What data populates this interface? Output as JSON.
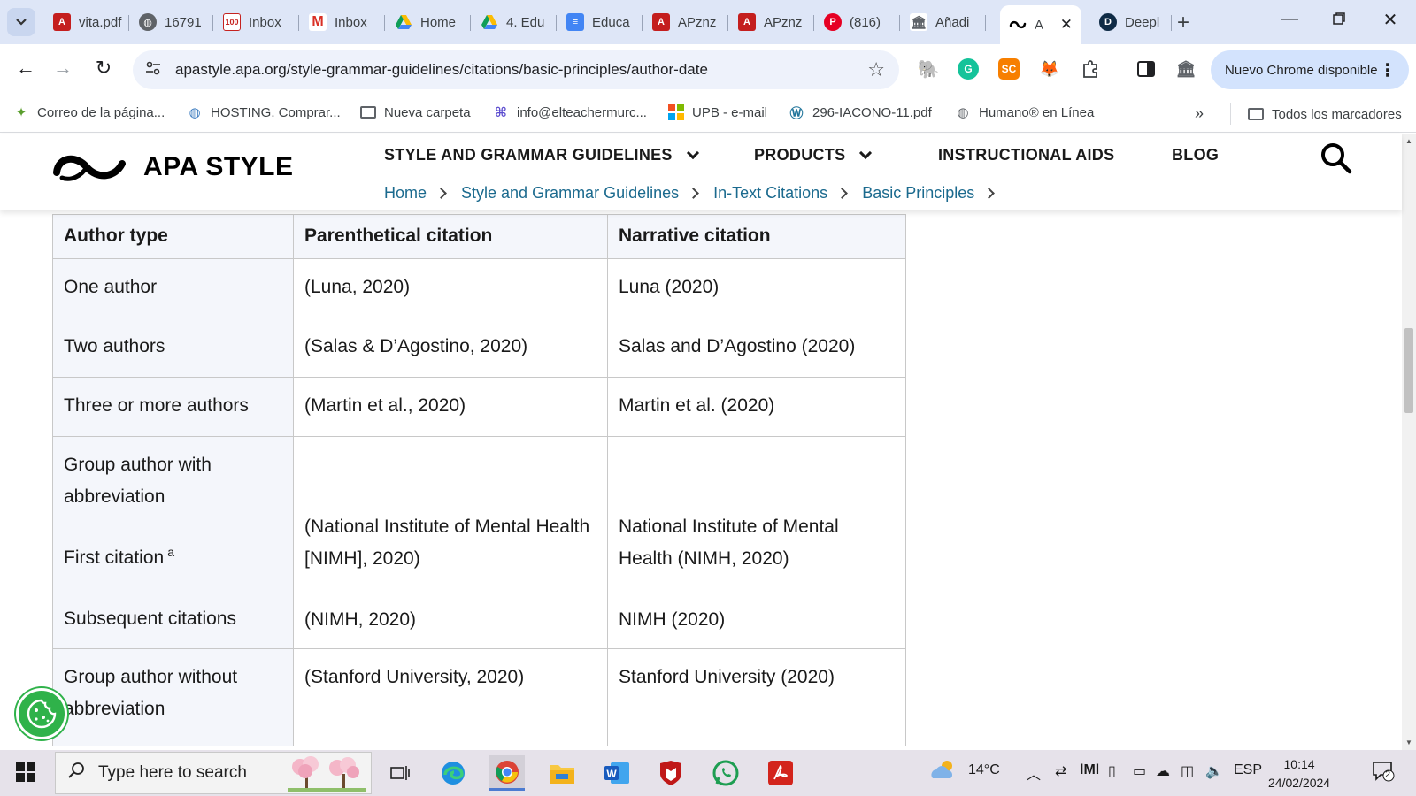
{
  "browser": {
    "tabs": [
      {
        "label": "vita.pdf",
        "icon": "pdf-icon",
        "color": "#c41e1e"
      },
      {
        "label": "16791",
        "icon": "globe-icon",
        "color": "#5f6368"
      },
      {
        "label": "Inbox",
        "icon": "mail-100-icon",
        "color": "#c5221f"
      },
      {
        "label": "Inbox",
        "icon": "gmail-icon",
        "color": "#d93025"
      },
      {
        "label": "Home",
        "icon": "drive-icon",
        "color": "#1a73e8"
      },
      {
        "label": "4. Edu",
        "icon": "drive-icon",
        "color": "#1a73e8"
      },
      {
        "label": "Educa",
        "icon": "docs-icon",
        "color": "#4285f4"
      },
      {
        "label": "APznz",
        "icon": "pdf-icon",
        "color": "#c41e1e"
      },
      {
        "label": "APznz",
        "icon": "pdf-icon",
        "color": "#c41e1e"
      },
      {
        "label": "(816)",
        "icon": "pinterest-icon",
        "color": "#e60023"
      },
      {
        "label": "Añadi",
        "icon": "museum-icon",
        "color": "#5f6368"
      },
      {
        "label": "A",
        "icon": "apa-icon",
        "color": "#000000",
        "active": true
      },
      {
        "label": "Deepl",
        "icon": "deepl-icon",
        "color": "#0f2b46"
      }
    ],
    "url": "apastyle.apa.org/style-grammar-guidelines/citations/basic-principles/author-date",
    "update_label": "Nuevo Chrome disponible",
    "bookmarks": [
      {
        "label": "Correo de la página...",
        "icon": "leaf-icon"
      },
      {
        "label": "HOSTING. Comprar...",
        "icon": "globe-icon"
      },
      {
        "label": "Nueva carpeta",
        "icon": "folder-icon"
      },
      {
        "label": "info@elteachermurc...",
        "icon": "mail-icon"
      },
      {
        "label": "UPB - e-mail",
        "icon": "microsoft-icon"
      },
      {
        "label": "296-IACONO-11.pdf",
        "icon": "wordpress-icon"
      },
      {
        "label": "Humano® en Línea",
        "icon": "globe-icon"
      }
    ],
    "all_bookmarks_label": "Todos los marcadores"
  },
  "site": {
    "logo_text": "APA STYLE",
    "nav": [
      {
        "label": "STYLE AND GRAMMAR GUIDELINES",
        "dropdown": true
      },
      {
        "label": "PRODUCTS",
        "dropdown": true
      },
      {
        "label": "INSTRUCTIONAL AIDS",
        "dropdown": false
      },
      {
        "label": "BLOG",
        "dropdown": false
      }
    ],
    "breadcrumbs": [
      "Home",
      "Style and Grammar Guidelines",
      "In-Text Citations",
      "Basic Principles"
    ]
  },
  "table": {
    "headers": [
      "Author type",
      "Parenthetical citation",
      "Narrative citation"
    ],
    "rows": [
      {
        "type": "One author",
        "paren": "(Luna, 2020)",
        "narr": "Luna (2020)"
      },
      {
        "type": "Two authors",
        "paren": "(Salas & D’Agostino, 2020)",
        "narr": "Salas and D’Agostino (2020)"
      },
      {
        "type": "Three or more authors",
        "paren": "(Martin et al., 2020)",
        "narr": "Martin et al. (2020)"
      }
    ],
    "group_with_abbr": {
      "type": "Group author with abbreviation",
      "first_label": "First citation",
      "first_sup": "a",
      "first_paren": "(National Institute of Mental Health [NIMH], 2020)",
      "first_narr": "National Institute of Mental Health (NIMH, 2020)",
      "subsequent_label": "Subsequent citations",
      "subsequent_paren": "(NIMH, 2020)",
      "subsequent_narr": "NIMH (2020)"
    },
    "group_without_abbr": {
      "type": "Group author without abbreviation",
      "paren": "(Stanford University, 2020)",
      "narr": "Stanford University (2020)"
    }
  },
  "taskbar": {
    "search_placeholder": "Type here to search",
    "weather": "14°C",
    "language": "ESP",
    "time": "10:14",
    "date": "24/02/2024",
    "notifications": "2"
  },
  "colors": {
    "link": "#1b6a8e",
    "tab_strip": "#dee6f7",
    "cookie": "#2fb24a"
  }
}
